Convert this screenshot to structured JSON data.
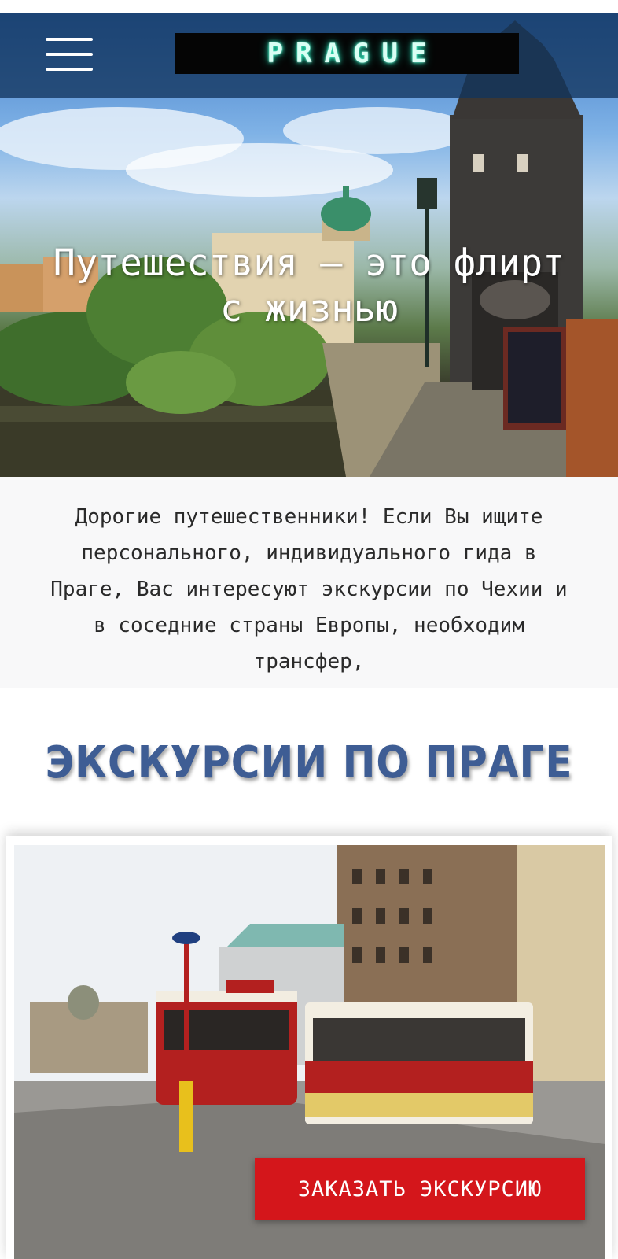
{
  "header": {
    "menu_icon": "hamburger-menu-icon",
    "logo_text": "PRAGUE"
  },
  "hero": {
    "title": "Путешествия – это флирт с жизнью"
  },
  "intro": {
    "text": "Дорогие путешественники! Если Вы ищите персонального, индивидуального гида в Праге, Вас интересуют экскурсии по Чехии и в соседние страны Европы, необходим трансфер,"
  },
  "tours_section": {
    "title": "ЭКСКУРСИИ ПО ПРАГЕ",
    "order_button_label": "ЗАКАЗАТЬ ЭКСКУРСИЮ"
  },
  "colors": {
    "section_title": "#3e5d94",
    "order_button": "#d4161b",
    "header_bar": "#12345e",
    "logo_glow": "#2ef0c0"
  }
}
